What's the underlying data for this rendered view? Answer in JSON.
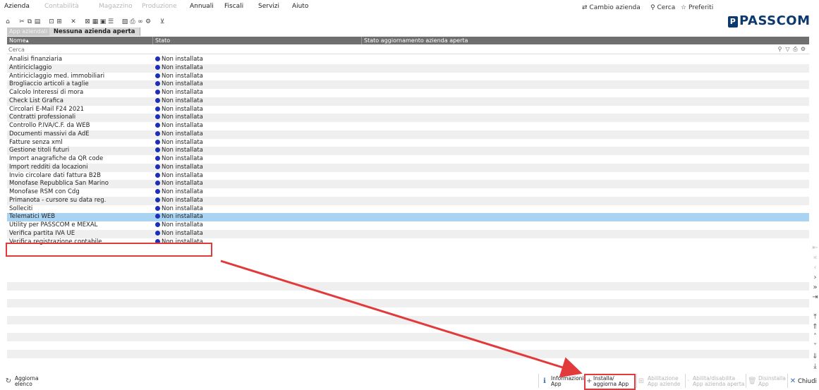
{
  "menubar": {
    "items": [
      {
        "label": "Azienda",
        "enabled": true
      },
      {
        "label": "Contabilità",
        "enabled": false
      },
      {
        "label": "Magazzino",
        "enabled": false
      },
      {
        "label": "Produzione",
        "enabled": false
      },
      {
        "label": "Annuali",
        "enabled": true
      },
      {
        "label": "Fiscali",
        "enabled": true
      },
      {
        "label": "Servizi",
        "enabled": true
      },
      {
        "label": "Aiuto",
        "enabled": true
      }
    ],
    "cambio_azienda": "Cambio azienda",
    "cerca": "Cerca",
    "preferiti": "Preferiti"
  },
  "brand": {
    "logo_text": "PASSCOM",
    "logo_mark": "P",
    "color": "#0d3a6e"
  },
  "tabs": {
    "inactive": "App aziendali",
    "active": "Nessuna azienda aperta"
  },
  "table": {
    "columns": [
      "Nome",
      "Stato",
      "Stato aggiornamento azienda aperta"
    ],
    "sort_indicator": "▴",
    "search_placeholder": "Cerca",
    "status_color": "#1d2fb8",
    "selected_row_color": "#a9d3f2",
    "rows": [
      {
        "name": "Analisi finanziaria",
        "status": "Non installata"
      },
      {
        "name": "Antiriciclaggio",
        "status": "Non installata"
      },
      {
        "name": "Antiriciclaggio med. immobiliari",
        "status": "Non installata"
      },
      {
        "name": "Brogliaccio articoli a taglie",
        "status": "Non installata"
      },
      {
        "name": "Calcolo Interessi di mora",
        "status": "Non installata"
      },
      {
        "name": "Check List Grafica",
        "status": "Non installata"
      },
      {
        "name": "Circolari E-Mail F24 2021",
        "status": "Non installata"
      },
      {
        "name": "Contratti professionali",
        "status": "Non installata"
      },
      {
        "name": "Controllo P.IVA/C.F. da WEB",
        "status": "Non installata"
      },
      {
        "name": "Documenti massivi da AdE",
        "status": "Non installata"
      },
      {
        "name": "Fatture senza xml",
        "status": "Non installata"
      },
      {
        "name": "Gestione titoli futuri",
        "status": "Non installata"
      },
      {
        "name": "Import anagrafiche da QR code",
        "status": "Non installata"
      },
      {
        "name": "Import redditi da locazioni",
        "status": "Non installata"
      },
      {
        "name": "Invio circolare dati fattura B2B",
        "status": "Non installata"
      },
      {
        "name": "Monofase Repubblica San Marino",
        "status": "Non installata"
      },
      {
        "name": "Monofase RSM con Cdg",
        "status": "Non installata"
      },
      {
        "name": "Primanota - cursore su data reg.",
        "status": "Non installata"
      },
      {
        "name": "Solleciti",
        "status": "Non installata"
      },
      {
        "name": "Telematici WEB",
        "status": "Non installata",
        "selected": true
      },
      {
        "name": "Utility per PASSCOM e MEXAL",
        "status": "Non installata"
      },
      {
        "name": "Verifica partita IVA UE",
        "status": "Non installata"
      },
      {
        "name": "Verifica registrazione contabile",
        "status": "Non installata"
      }
    ]
  },
  "bottombar": {
    "aggiorna": "Aggiorna\nelenco",
    "informazioni": "Informazioni\nApp",
    "installa": "Installa/\naggiorna App",
    "abilitazione": "Abilitazione\nApp aziende",
    "abilita_disabilita": "Abilita/disabilita\nApp azienda aperta",
    "disinstalla": "Disinstalla\nApp",
    "chiudi": "Chiudi"
  },
  "annotation": {
    "color": "#e23a3a"
  }
}
